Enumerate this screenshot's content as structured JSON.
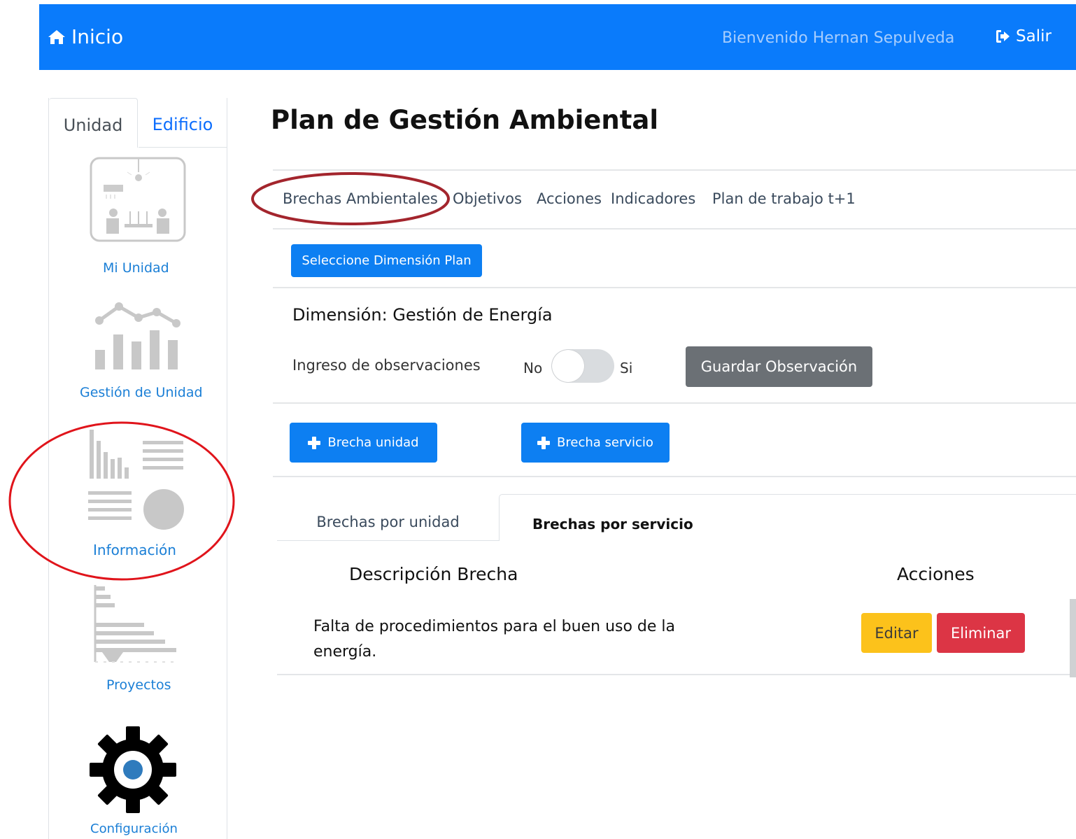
{
  "navbar": {
    "brand": "Inicio",
    "welcome": "Bienvenido Hernan Sepulveda",
    "logout": "Salir",
    "color": "#0a7bfb"
  },
  "sidebar": {
    "tabs": [
      "Unidad",
      "Edificio"
    ],
    "items": [
      {
        "label": "Mi Unidad",
        "icon": "meeting-room-icon"
      },
      {
        "label": "Gestión de Unidad",
        "icon": "bar-line-chart-icon"
      },
      {
        "label": "Información",
        "icon": "reports-icon"
      },
      {
        "label": "Proyectos",
        "icon": "gantt-chart-icon"
      },
      {
        "label": "Configuración",
        "icon": "gear-icon"
      }
    ]
  },
  "main": {
    "title": "Plan de Gestión Ambiental",
    "subnav": [
      "Brechas Ambientales",
      "Objetivos",
      "Acciones",
      "Indicadores",
      "Plan de trabajo t+1"
    ],
    "select_dimension_button": "Seleccione Dimensión Plan",
    "dimension": "Dimensión: Gestión de Energía",
    "observation_label": "Ingreso de observaciones",
    "toggle_no": "No",
    "toggle_si": "Si",
    "toggle_on": false,
    "save_observation_button": "Guardar Observación",
    "add_unit_gap_button": "Brecha unidad",
    "add_service_gap_button": "Brecha servicio",
    "tabs": [
      "Brechas por unidad",
      "Brechas por servicio"
    ],
    "active_tab": "Brechas por servicio",
    "table": {
      "headers": [
        "Descripción Brecha",
        "Acciones"
      ],
      "rows": [
        {
          "description": "Falta de procedimientos para el buen uso de la energía.",
          "edit": "Editar",
          "delete": "Eliminar"
        }
      ]
    }
  },
  "colors": {
    "primary": "#0d7ff2",
    "secondary": "#6b7075",
    "warning": "#fcc21b",
    "danger": "#dc3545",
    "annotation_red": "#e0141b",
    "annotation_dark_red": "#a3252d"
  }
}
